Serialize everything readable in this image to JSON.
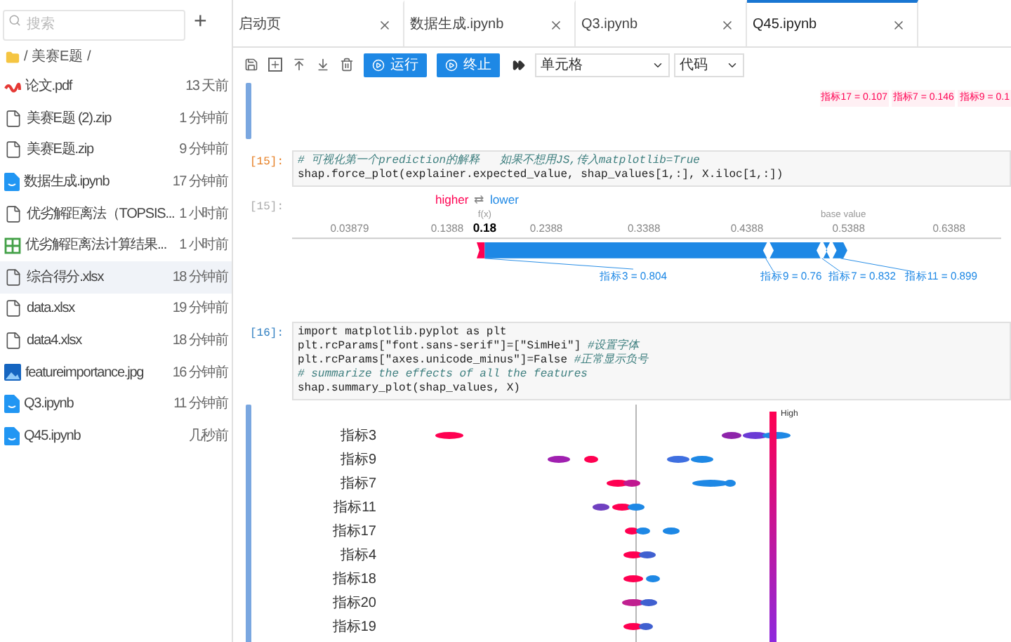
{
  "sidebar": {
    "search": {
      "placeholder": "搜索"
    },
    "new_button": "+",
    "breadcrumb": "/ 美赛E题 /",
    "files": [
      {
        "name": "论文.pdf",
        "modified": "13 天前",
        "kind": "pdf",
        "selected": false
      },
      {
        "name": "美赛E题 (2).zip",
        "modified": "1 分钟前",
        "kind": "file",
        "selected": false
      },
      {
        "name": "美赛E题.zip",
        "modified": "9 分钟前",
        "kind": "file",
        "selected": false
      },
      {
        "name": "数据生成.ipynb",
        "modified": "17 分钟前",
        "kind": "notebook",
        "selected": false
      },
      {
        "name": "优劣解距离法（TOPSIS...",
        "modified": "1 小时前",
        "kind": "file",
        "selected": false
      },
      {
        "name": "优劣解距离法计算结果...",
        "modified": "1 小时前",
        "kind": "table",
        "selected": false
      },
      {
        "name": "综合得分.xlsx",
        "modified": "18 分钟前",
        "kind": "file",
        "selected": true
      },
      {
        "name": "data.xlsx",
        "modified": "19 分钟前",
        "kind": "file",
        "selected": false
      },
      {
        "name": "data4.xlsx",
        "modified": "18 分钟前",
        "kind": "file",
        "selected": false
      },
      {
        "name": "featureimportance.jpg",
        "modified": "16 分钟前",
        "kind": "image",
        "selected": false
      },
      {
        "name": "Q3.ipynb",
        "modified": "11 分钟前",
        "kind": "notebook",
        "selected": false
      },
      {
        "name": "Q45.ipynb",
        "modified": "几秒前",
        "kind": "notebook",
        "selected": false
      }
    ]
  },
  "tabs": [
    {
      "label": "启动页",
      "selected": false
    },
    {
      "label": "数据生成.ipynb",
      "selected": false
    },
    {
      "label": "Q3.ipynb",
      "selected": false
    },
    {
      "label": "Q45.ipynb",
      "selected": true
    }
  ],
  "toolbar": {
    "run_button": "运行",
    "stop_button": "终止",
    "cell_select": "单元格",
    "type_select": "代码"
  },
  "top_output": {
    "labels": [
      "指标17 = 0.107",
      "指标7 = 0.146",
      "指标9 = 0.1"
    ]
  },
  "cells": [
    {
      "prompt": "[15]:",
      "lines": [
        {
          "comment": "# 可视化第一个prediction的解释   如果不想用JS,传入matplotlib=True"
        },
        {
          "code": "shap.force_plot(explainer.expected_value, shap_values[1,:], X.iloc[1,:])"
        }
      ],
      "output": {
        "prompt": "[15]:",
        "kind": "force_plot",
        "higher": "higher",
        "arrows": "⇄",
        "lower": "lower",
        "fx": "f(x)",
        "base_label": "base value",
        "ticks": [
          "0.03879",
          "0.1388",
          "0.18",
          "0.2388",
          "0.3388",
          "0.4388",
          "0.5388",
          "0.6388"
        ],
        "features": [
          "指标3 = 0.804",
          "指标9 = 0.76",
          "指标7 = 0.832",
          "指标11 = 0.899"
        ]
      }
    },
    {
      "prompt": "[16]:",
      "lines": [
        {
          "code": "import matplotlib.pyplot as plt"
        },
        {
          "code": "plt.rcParams[\"font.sans-serif\"]=[\"SimHei\"] ",
          "comment": "#设置字体"
        },
        {
          "code": "plt.rcParams[\"axes.unicode_minus\"]=False ",
          "comment": "#正常显示负号"
        },
        {
          "comment": "# summarize the effects of all the features"
        },
        {
          "code": "shap.summary_plot(shap_values, X)"
        }
      ],
      "output": {
        "kind": "summary_plot",
        "features": [
          "指标3",
          "指标9",
          "指标7",
          "指标11",
          "指标17",
          "指标4",
          "指标18",
          "指标20",
          "指标19"
        ],
        "colorbar_label": "High"
      }
    }
  ]
}
